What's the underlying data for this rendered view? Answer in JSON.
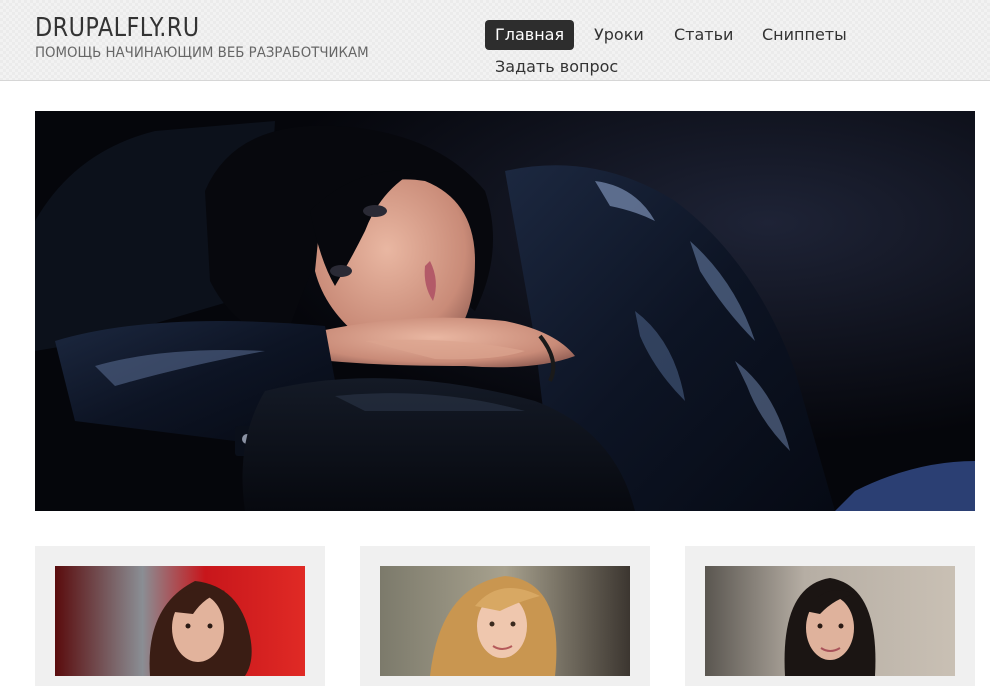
{
  "header": {
    "site_name": "DRUPALFLY.RU",
    "slogan": "ПОМОЩЬ НАЧИНАЮЩИМ ВЕБ РАЗРАБОТЧИКАМ"
  },
  "nav": {
    "items": [
      {
        "label": "Главная",
        "active": true
      },
      {
        "label": "Уроки",
        "active": false
      },
      {
        "label": "Статьи",
        "active": false
      },
      {
        "label": "Сниппеты",
        "active": false
      },
      {
        "label": "Задать вопрос",
        "active": false
      }
    ]
  },
  "colors": {
    "header_bg": "#ebebeb",
    "nav_active_bg": "#2d2d2d",
    "nav_active_text": "#ffffff",
    "card_bg": "#f0f0f0"
  }
}
